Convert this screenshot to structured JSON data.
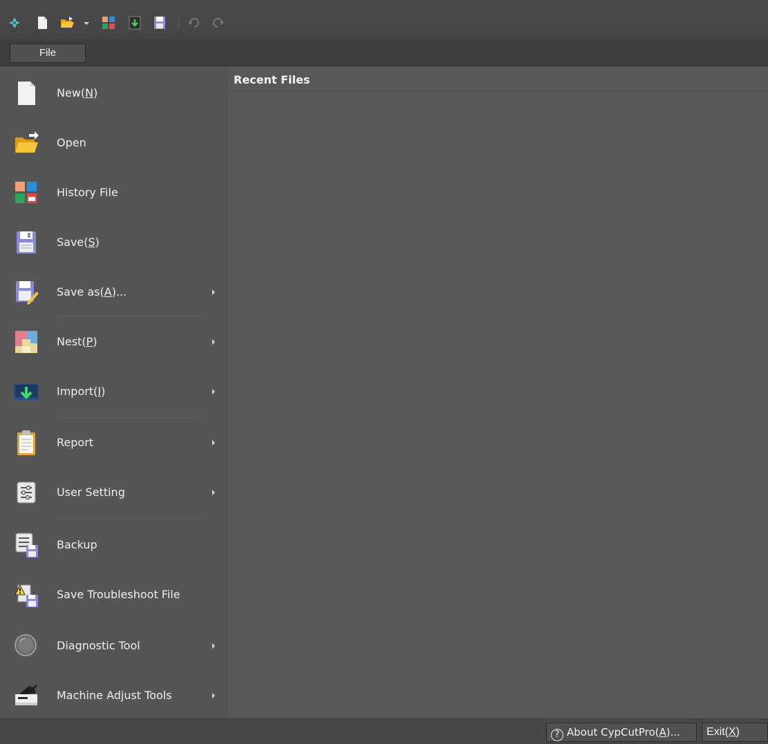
{
  "ribbon": {
    "file_tab": "File"
  },
  "menu": {
    "items": [
      {
        "name": "new",
        "label": "New(",
        "key": "N",
        "tail": ")",
        "submenu": false,
        "icon": "new-document-icon"
      },
      {
        "name": "open",
        "label": "Open",
        "key": "",
        "tail": "",
        "submenu": false,
        "icon": "open-folder-icon"
      },
      {
        "name": "history-file",
        "label": "History File",
        "key": "",
        "tail": "",
        "submenu": false,
        "icon": "history-grid-icon"
      },
      {
        "name": "save",
        "label": "Save(",
        "key": "S",
        "tail": ")",
        "submenu": false,
        "icon": "floppy-disk-icon"
      },
      {
        "name": "save-as",
        "label": "Save as(",
        "key": "A",
        "tail": ")...",
        "submenu": true,
        "icon": "save-as-icon"
      },
      {
        "name": "nest",
        "label": "Nest(",
        "key": "P",
        "tail": ")",
        "submenu": true,
        "icon": "nest-icon"
      },
      {
        "name": "import",
        "label": "Import(",
        "key": "I",
        "tail": ")",
        "submenu": true,
        "icon": "import-icon"
      },
      {
        "name": "report",
        "label": "Report",
        "key": "",
        "tail": "",
        "submenu": true,
        "icon": "clipboard-icon"
      },
      {
        "name": "user-setting",
        "label": "User Setting",
        "key": "",
        "tail": "",
        "submenu": true,
        "icon": "settings-sliders-icon"
      },
      {
        "name": "backup",
        "label": "Backup",
        "key": "",
        "tail": "",
        "submenu": false,
        "icon": "backup-icon"
      },
      {
        "name": "save-troubleshoot-file",
        "label": "Save Troubleshoot File",
        "key": "",
        "tail": "",
        "submenu": false,
        "icon": "warning-save-icon"
      },
      {
        "name": "diagnostic-tool",
        "label": "Diagnostic Tool",
        "key": "",
        "tail": "",
        "submenu": true,
        "icon": "magnifier-icon"
      },
      {
        "name": "machine-adjust-tools",
        "label": "Machine Adjust Tools",
        "key": "",
        "tail": "",
        "submenu": true,
        "icon": "machine-adjust-icon"
      }
    ]
  },
  "recent": {
    "title": "Recent Files"
  },
  "footer": {
    "about_label": "About CypCutPro(",
    "about_key": "A",
    "about_tail": ")...",
    "exit_label": "Exit(",
    "exit_key": "X",
    "exit_tail": ")"
  },
  "colors": {
    "background": "#4a4a4a",
    "menu_bg": "#555555",
    "content_bg": "#585858",
    "text": "#efefef"
  }
}
